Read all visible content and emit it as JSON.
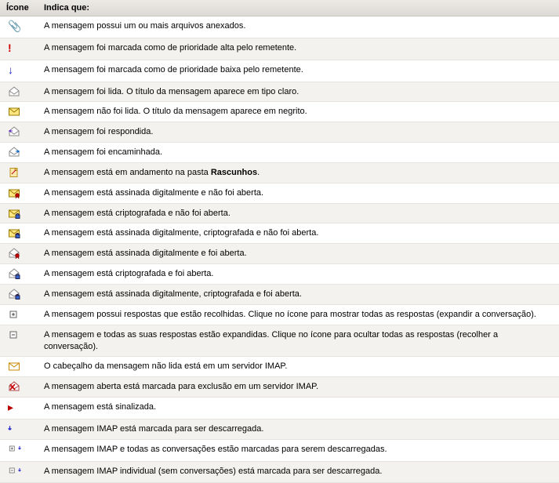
{
  "headers": {
    "icon": "Ícone",
    "desc": "Indica que:"
  },
  "rows": [
    {
      "icon": "attachment",
      "desc": "A mensagem possui um ou mais arquivos anexados."
    },
    {
      "icon": "priority-high",
      "desc": "A mensagem foi marcada como de prioridade alta pelo remetente."
    },
    {
      "icon": "priority-low",
      "desc": "A mensagem foi marcada como de prioridade baixa pelo remetente."
    },
    {
      "icon": "read",
      "desc": "A mensagem foi lida. O título da mensagem aparece em tipo claro."
    },
    {
      "icon": "unread",
      "desc": "A mensagem não foi lida. O título da mensagem aparece em negrito."
    },
    {
      "icon": "replied",
      "desc": "A mensagem foi respondida."
    },
    {
      "icon": "forwarded",
      "desc": "A mensagem foi encaminhada."
    },
    {
      "icon": "draft",
      "desc_pre": "A mensagem está em andamento na pasta ",
      "desc_bold": "Rascunhos",
      "desc_post": "."
    },
    {
      "icon": "signed-unread",
      "desc": "A mensagem está assinada digitalmente e não foi aberta."
    },
    {
      "icon": "encrypted-unread",
      "desc": "A mensagem está criptografada e não foi aberta."
    },
    {
      "icon": "signed-enc-unread",
      "desc": "A mensagem está assinada digitalmente, criptografada e não foi aberta."
    },
    {
      "icon": "signed-read",
      "desc": "A mensagem está assinada digitalmente e foi aberta."
    },
    {
      "icon": "encrypted-read",
      "desc": "A mensagem está criptografada e foi aberta."
    },
    {
      "icon": "signed-enc-read",
      "desc": "A mensagem está assinada digitalmente, criptografada e foi aberta."
    },
    {
      "icon": "expand",
      "desc": "A mensagem possui respostas que estão recolhidas. Clique no ícone para mostrar todas as respostas (expandir a conversação)."
    },
    {
      "icon": "collapse",
      "desc": "A mensagem e todas as suas respostas estão expandidas. Clique no ícone para ocultar todas as respostas (recolher a conversação)."
    },
    {
      "icon": "imap-header",
      "desc": "O cabeçalho da mensagem não lida está em um servidor IMAP."
    },
    {
      "icon": "imap-delete",
      "desc": "A mensagem aberta está marcada para exclusão em um servidor IMAP."
    },
    {
      "icon": "flagged",
      "desc": "A mensagem está sinalizada."
    },
    {
      "icon": "download",
      "desc": "A mensagem IMAP está marcada para ser descarregada."
    },
    {
      "icon": "download-conv",
      "desc": "A mensagem IMAP e todas as conversações estão marcadas para serem descarregadas."
    },
    {
      "icon": "download-single",
      "desc": "A mensagem IMAP individual (sem conversações) está marcada para ser descarregada."
    }
  ]
}
